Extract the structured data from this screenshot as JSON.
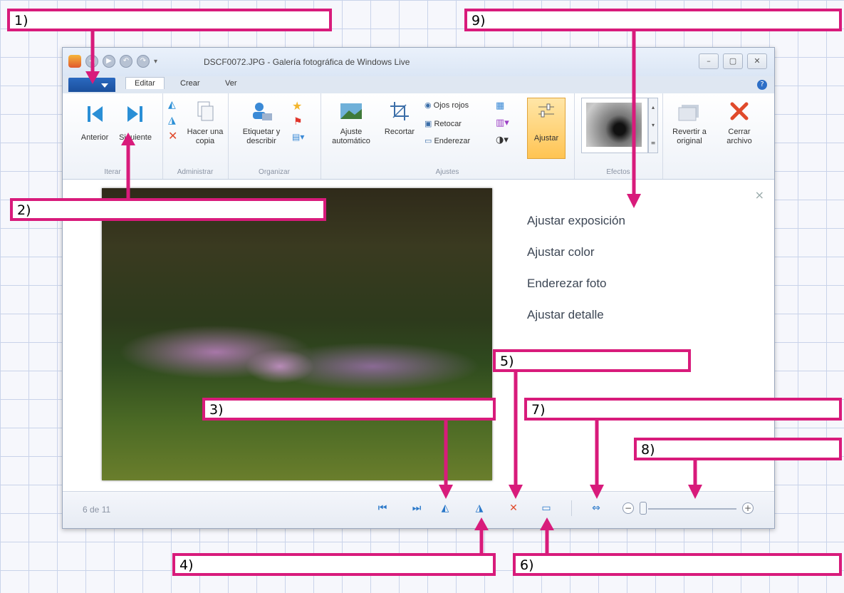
{
  "window": {
    "title": "DSCF0072.JPG - Galería fotográfica de Windows Live",
    "minimize": "–",
    "maximize": "▢",
    "close": "✕"
  },
  "tabs": {
    "file": "",
    "items": [
      "Editar",
      "Crear",
      "Ver"
    ],
    "help": "?"
  },
  "ribbon": {
    "groups": {
      "iterar": "Iterar",
      "administrar": "Administrar",
      "organizar": "Organizar",
      "ajustes": "Ajustes",
      "efectos": "Efectos"
    },
    "anterior": "Anterior",
    "siguiente": "Siguiente",
    "hacer_copia": "Hacer una copia",
    "etiquetar": "Etiquetar y describir",
    "ajuste_automatico": "Ajuste automático",
    "recortar": "Recortar",
    "ojos_rojos": "Ojos rojos",
    "retocar": "Retocar",
    "enderezar": "Enderezar",
    "ajustar": "Ajustar",
    "revertir": "Revertir a original",
    "cerrar": "Cerrar archivo"
  },
  "panel": {
    "close": "×",
    "items": [
      "Ajustar exposición",
      "Ajustar color",
      "Enderezar foto",
      "Ajustar detalle"
    ]
  },
  "status": {
    "count": "6 de 11"
  },
  "callouts": [
    "1)",
    "2)",
    "3)",
    "4)",
    "5)",
    "6)",
    "7)",
    "8)",
    "9)"
  ],
  "colors": {
    "callout_border": "#d81b7b",
    "accent_blue": "#2a78c9",
    "close_red": "#e04a2b"
  }
}
